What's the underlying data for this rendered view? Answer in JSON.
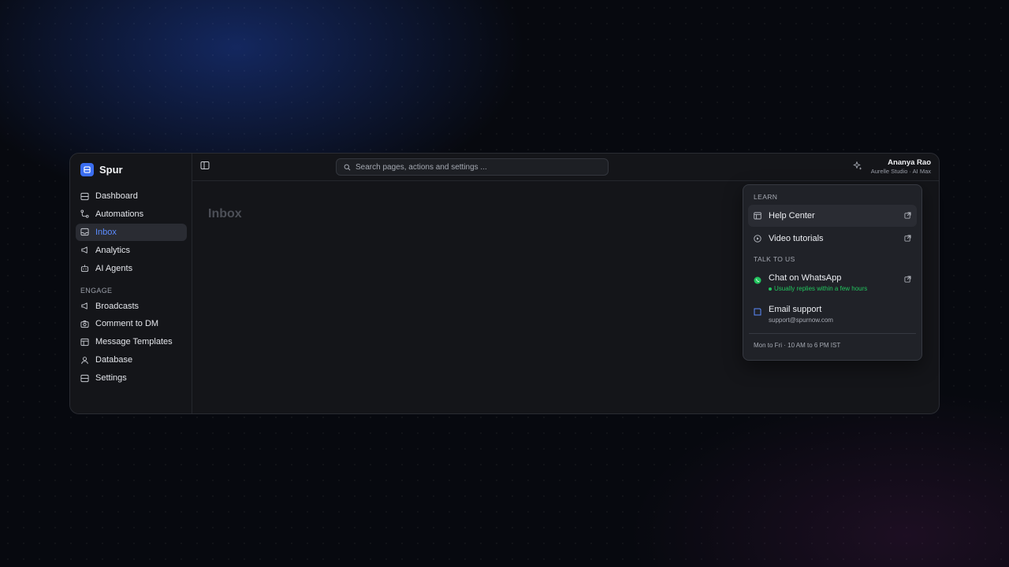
{
  "app": {
    "name": "Spur"
  },
  "sidebar": {
    "items": [
      {
        "label": "Dashboard"
      },
      {
        "label": "Automations"
      },
      {
        "label": "Inbox"
      },
      {
        "label": "Analytics"
      },
      {
        "label": "AI Agents"
      }
    ],
    "section_label": "ENGAGE",
    "engage_items": [
      {
        "label": "Broadcasts"
      },
      {
        "label": "Comment to DM"
      },
      {
        "label": "Message Templates"
      },
      {
        "label": "Database"
      },
      {
        "label": "Settings"
      }
    ],
    "active_item": "Inbox"
  },
  "search": {
    "placeholder": "Search pages, actions and settings ..."
  },
  "user": {
    "name": "Ananya Rao",
    "subtitle": "Aurelle Studio · AI Max"
  },
  "page": {
    "title": "Inbox"
  },
  "help_menu": {
    "learn_label": "LEARN",
    "help_center": "Help Center",
    "video_tutorials": "Video tutorials",
    "talk_label": "TALK TO US",
    "whatsapp": "Chat on WhatsApp",
    "whatsapp_status": "Usually replies within a few hours",
    "email_support": "Email support",
    "email_address": "support@spurnow.com",
    "hours": "Mon to Fri · 10 AM to 6 PM IST"
  },
  "colors": {
    "accent": "#3a6df0",
    "active_text": "#5b8cff",
    "whatsapp": "#22c55e"
  }
}
